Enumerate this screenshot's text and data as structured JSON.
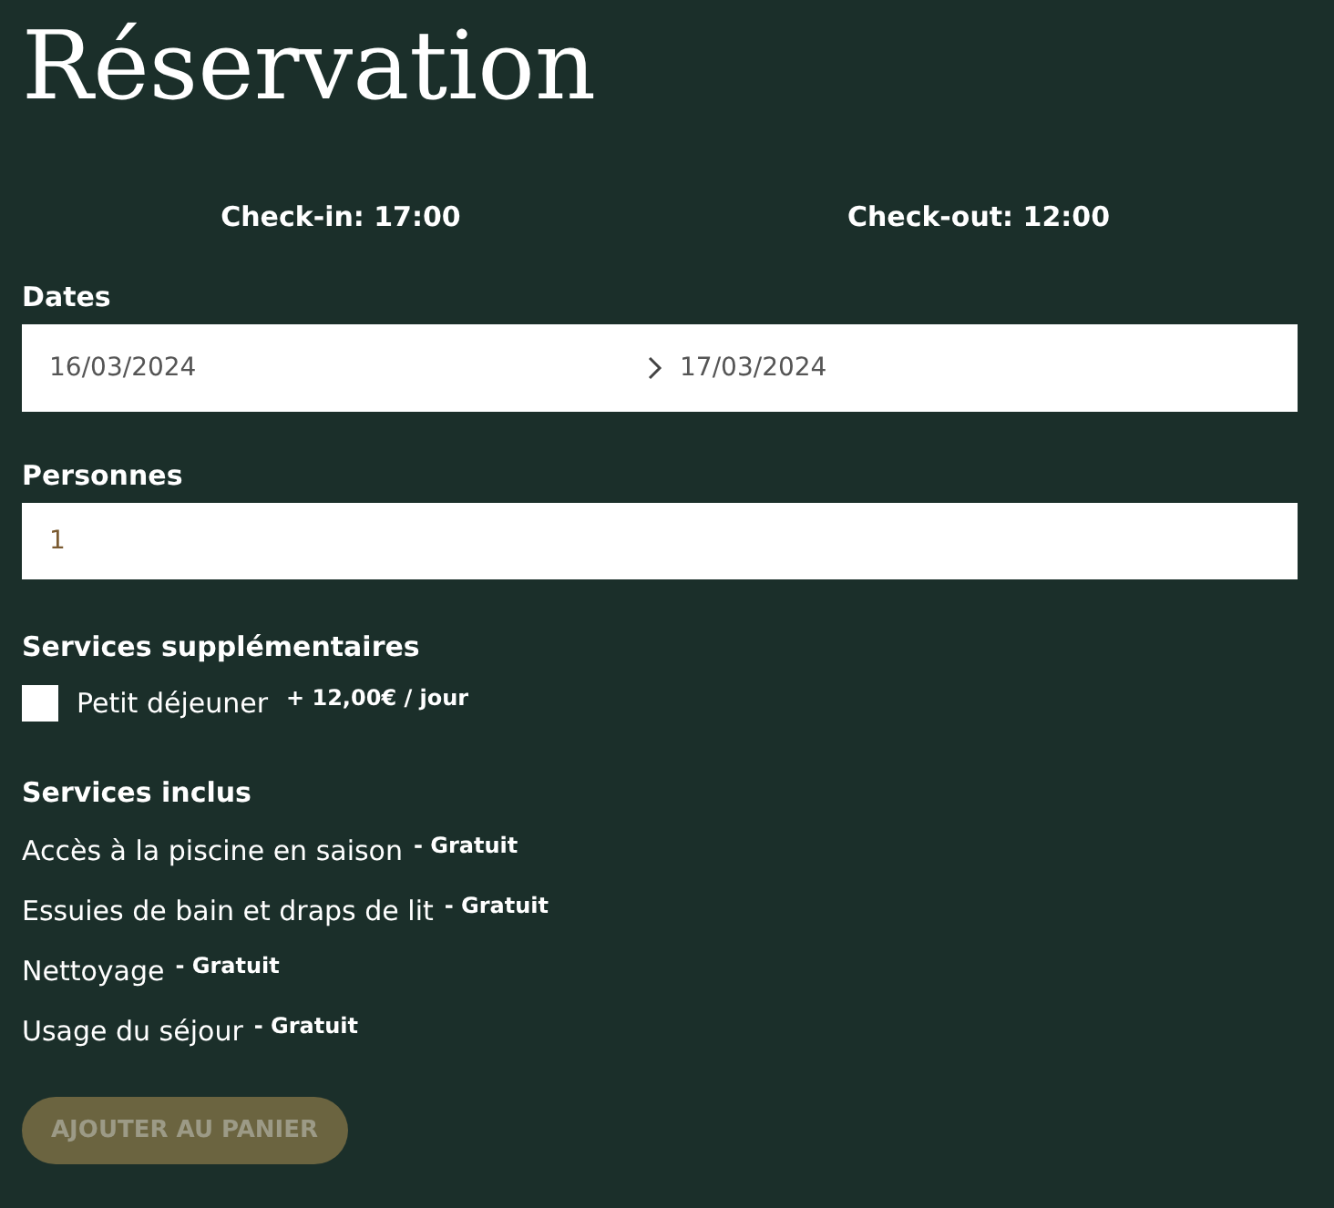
{
  "title": "Réservation",
  "check_times": [
    {
      "text": "Check-in: 17:00"
    },
    {
      "text": "Check-out: 12:00"
    }
  ],
  "dates": {
    "label": "Dates",
    "start": "16/03/2024",
    "end": "17/03/2024"
  },
  "persons": {
    "label": "Personnes",
    "value": "1"
  },
  "extra_services": {
    "heading": "Services supplémentaires",
    "items": [
      {
        "label": "Petit déjeuner",
        "price": "+ 12,00€ / jour",
        "checked": false
      }
    ]
  },
  "included_services": {
    "heading": "Services inclus",
    "items": [
      {
        "label": "Accès à la piscine en saison",
        "price": "- Gratuit"
      },
      {
        "label": "Essuies de bain et draps de lit",
        "price": "- Gratuit"
      },
      {
        "label": "Nettoyage",
        "price": "- Gratuit"
      },
      {
        "label": "Usage du séjour",
        "price": "- Gratuit"
      }
    ]
  },
  "add_button": {
    "label": "AJOUTER AU PANIER",
    "disabled": true
  }
}
